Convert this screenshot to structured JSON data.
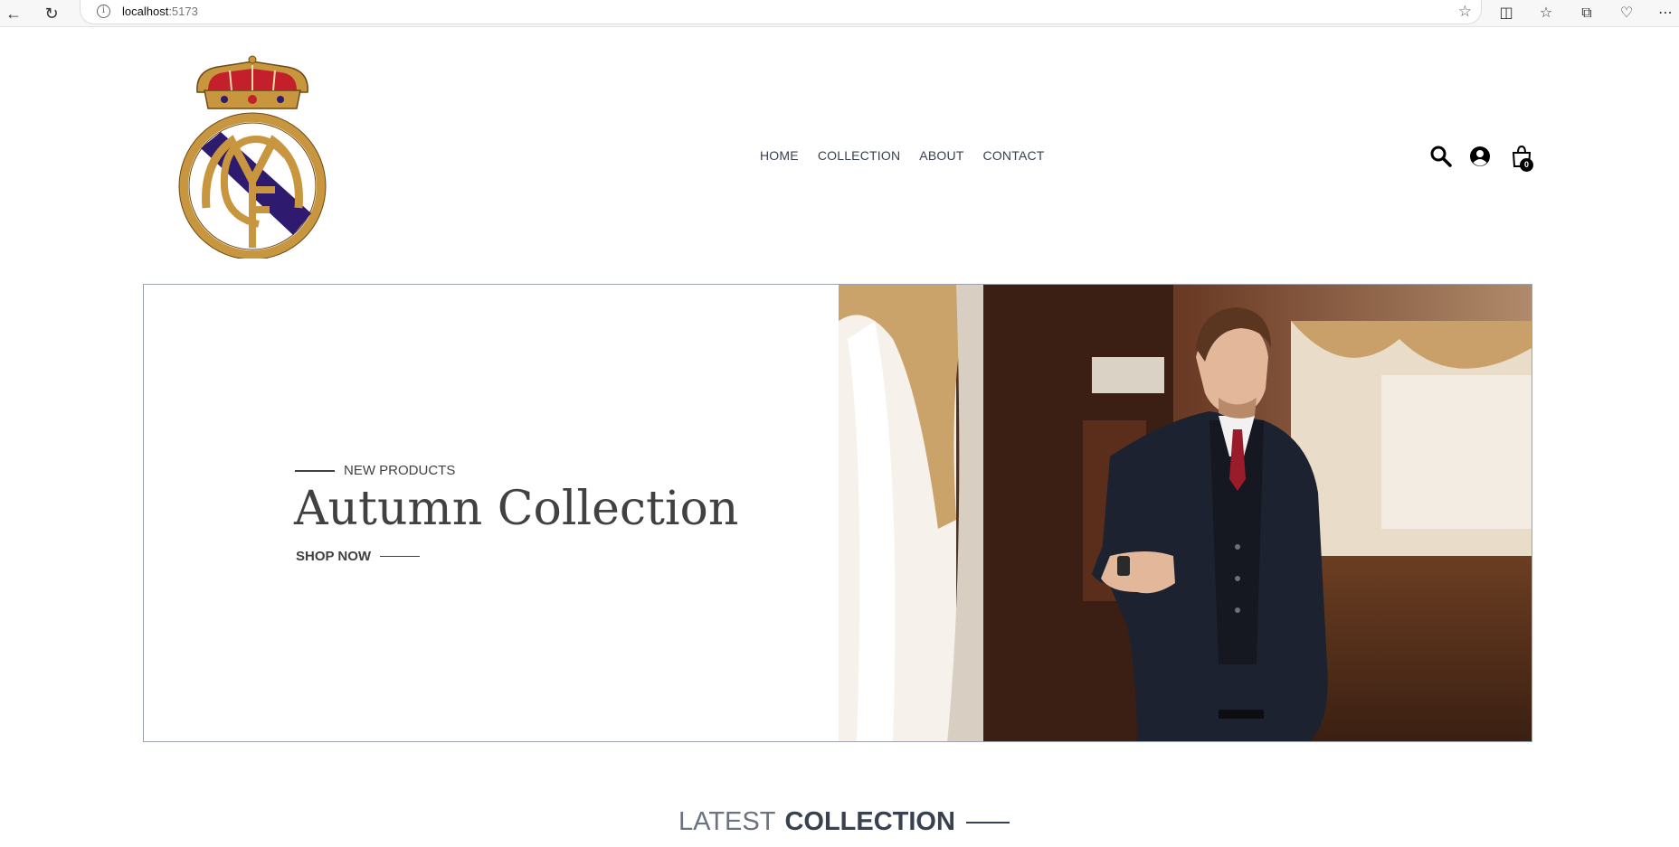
{
  "browser": {
    "url_host": "localhost",
    "url_port": ":5173"
  },
  "nav": {
    "items": [
      {
        "label": "HOME"
      },
      {
        "label": "COLLECTION"
      },
      {
        "label": "ABOUT"
      },
      {
        "label": "CONTACT"
      }
    ]
  },
  "header": {
    "cart_count": "0"
  },
  "hero": {
    "tagline": "NEW PRODUCTS",
    "title": "Autumn Collection",
    "cta": "SHOP NOW"
  },
  "latest": {
    "title_light": "LATEST",
    "title_bold": "COLLECTION"
  },
  "colors": {
    "logo_gold": "#c8963e",
    "logo_purple": "#2e1a6e",
    "logo_red": "#c4202c",
    "text_dark": "#414141"
  }
}
